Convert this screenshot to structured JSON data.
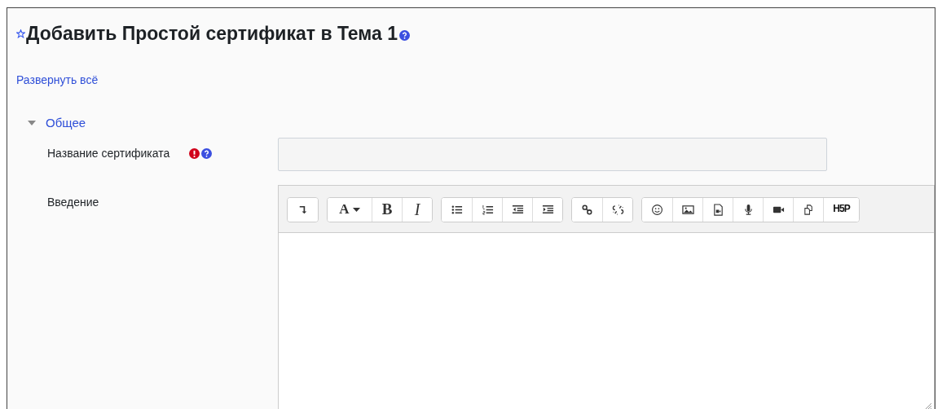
{
  "heading": {
    "title": "Добавить Простой сертификат в Тема 1",
    "starred": false
  },
  "expand_all_link": "Развернуть всё",
  "section": {
    "title": "Общее",
    "expanded": true
  },
  "fields": [
    {
      "label": "Название сертификата",
      "required": true,
      "help": true,
      "kind": "text"
    },
    {
      "label": "Введение",
      "required": false,
      "help": false,
      "kind": "editor"
    }
  ],
  "toolbar_groups": [
    [
      {
        "kind": "collapse"
      }
    ],
    [
      {
        "kind": "font",
        "glyph": "A"
      },
      {
        "kind": "bold",
        "glyph": "B"
      },
      {
        "kind": "italic",
        "glyph": "I"
      }
    ],
    [
      {
        "kind": "bullets"
      },
      {
        "kind": "numbers"
      },
      {
        "kind": "outdent"
      },
      {
        "kind": "indent"
      }
    ],
    [
      {
        "kind": "link"
      },
      {
        "kind": "unlink"
      }
    ],
    [
      {
        "kind": "emoji"
      },
      {
        "kind": "image"
      },
      {
        "kind": "media"
      },
      {
        "kind": "audio"
      },
      {
        "kind": "video"
      },
      {
        "kind": "copy"
      },
      {
        "kind": "h5p",
        "glyph": "H5P"
      }
    ]
  ]
}
